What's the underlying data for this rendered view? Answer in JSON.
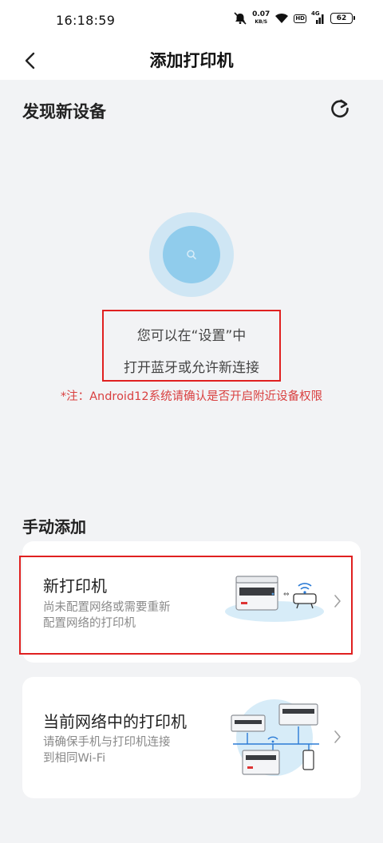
{
  "status_bar": {
    "time": "16:18:59",
    "net_speed_value": "0.07",
    "net_speed_unit": "KB/S",
    "hd_badge": "HD",
    "signal_label": "4G",
    "battery_level": "62"
  },
  "header": {
    "title": "添加打印机",
    "back_icon": "chevron-left-icon"
  },
  "discover": {
    "title": "发现新设备",
    "refresh_icon": "refresh-icon",
    "hint_line1": "您可以在“设置”中",
    "hint_line2": "打开蓝牙或允许新连接",
    "note": "*注：Android12系统请确认是否开启附近设备权限"
  },
  "manual": {
    "title": "手动添加",
    "cards": [
      {
        "title": "新打印机",
        "desc_line1": "尚未配置网络或需要重新",
        "desc_line2": "配置网络的打印机"
      },
      {
        "title": "当前网络中的打印机",
        "desc_line1": "请确保手机与打印机连接",
        "desc_line2": "到相同Wi-Fi"
      }
    ]
  },
  "colors": {
    "accent_red": "#e02020",
    "note_red": "#d94040",
    "radar_outer": "#cfe6f4",
    "radar_inner": "#90ccec",
    "background": "#f2f3f5"
  }
}
